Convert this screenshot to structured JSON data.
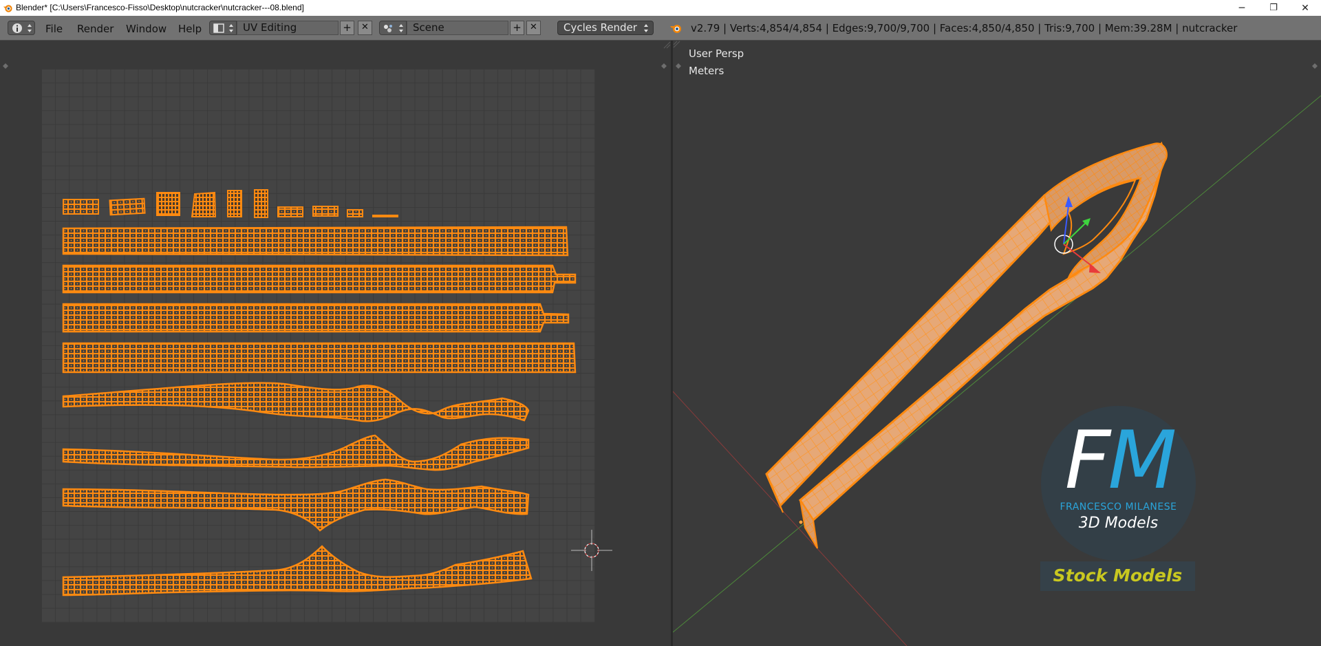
{
  "window": {
    "title": "Blender* [C:\\Users\\Francesco-Fisso\\Desktop\\nutcracker\\nutcracker---08.blend]",
    "minimize_glyph": "─",
    "restore_glyph": "❐",
    "close_glyph": "✕"
  },
  "header": {
    "info_icon": "info-icon",
    "menus": [
      "File",
      "Render",
      "Window",
      "Help"
    ],
    "screen_layout": "UV Editing",
    "scene": "Scene",
    "add_glyph": "+",
    "remove_glyph": "✕",
    "render_engine": "Cycles Render",
    "stats": "v2.79 | Verts:4,854/4,854 | Edges:9,700/9,700 | Faces:4,850/4,850 | Tris:9,700 | Mem:39.28M | nutcracker"
  },
  "viewport": {
    "view_name": "User Persp",
    "units": "Meters"
  },
  "watermark": {
    "fm_f": "F",
    "fm_m": "M",
    "name": "FRANCESCO MILANESE",
    "subtitle": "3D Models",
    "tagline": "Stock Models"
  },
  "colors": {
    "mesh_orange": "#ff8a10",
    "mesh_face": "#e6a877",
    "brand_blue": "#2aa5db",
    "stock_yellow": "#c9c820"
  }
}
